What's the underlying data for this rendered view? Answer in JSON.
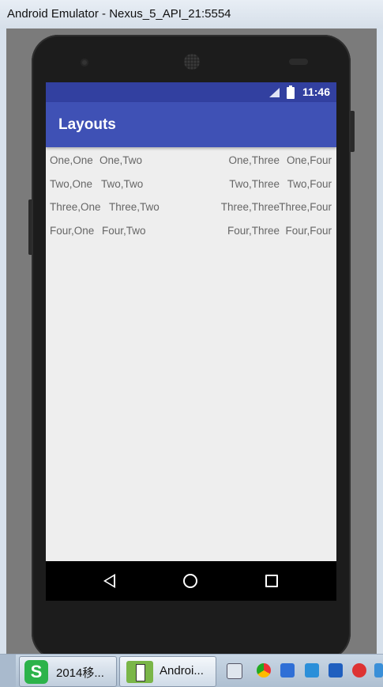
{
  "window": {
    "title": "Android Emulator - Nexus_5_API_21:5554"
  },
  "status_bar": {
    "time": "11:46",
    "signal_icon": "signal-icon",
    "battery_icon": "battery-icon"
  },
  "app": {
    "title": "Layouts"
  },
  "table": {
    "rows": [
      [
        "One,One",
        "One,Two",
        "One,Three",
        "One,Four"
      ],
      [
        "Two,One",
        "Two,Two",
        "Two,Three",
        "Two,Four"
      ],
      [
        "Three,One",
        "Three,Two",
        "Three,Three",
        "Three,Four"
      ],
      [
        "Four,One",
        "Four,Two",
        "Four,Three",
        "Four,Four"
      ]
    ]
  },
  "taskbar": {
    "items": [
      {
        "label": "2014移...",
        "icon": "wps-icon"
      },
      {
        "label": "Androi...",
        "icon": "android-studio-icon"
      }
    ]
  },
  "colors": {
    "appbar": "#3f51b5",
    "statusbar": "#3240a0",
    "content_bg": "#eeeeee",
    "cell_text": "#666666"
  }
}
